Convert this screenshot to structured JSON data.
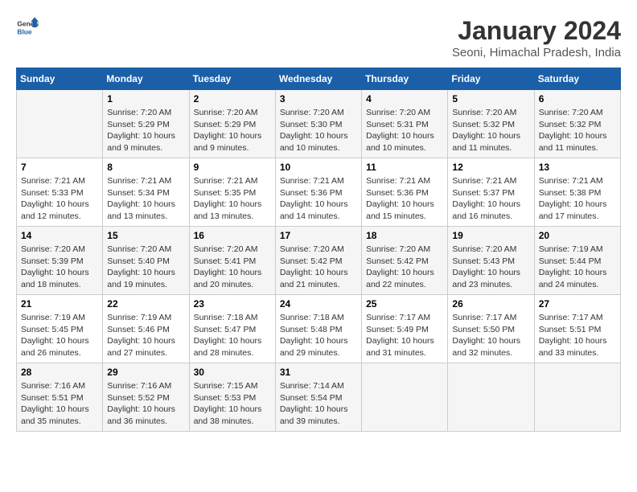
{
  "logo": {
    "text_general": "General",
    "text_blue": "Blue"
  },
  "header": {
    "month": "January 2024",
    "location": "Seoni, Himachal Pradesh, India"
  },
  "weekdays": [
    "Sunday",
    "Monday",
    "Tuesday",
    "Wednesday",
    "Thursday",
    "Friday",
    "Saturday"
  ],
  "weeks": [
    [
      {
        "day": "",
        "info": ""
      },
      {
        "day": "1",
        "info": "Sunrise: 7:20 AM\nSunset: 5:29 PM\nDaylight: 10 hours\nand 9 minutes."
      },
      {
        "day": "2",
        "info": "Sunrise: 7:20 AM\nSunset: 5:29 PM\nDaylight: 10 hours\nand 9 minutes."
      },
      {
        "day": "3",
        "info": "Sunrise: 7:20 AM\nSunset: 5:30 PM\nDaylight: 10 hours\nand 10 minutes."
      },
      {
        "day": "4",
        "info": "Sunrise: 7:20 AM\nSunset: 5:31 PM\nDaylight: 10 hours\nand 10 minutes."
      },
      {
        "day": "5",
        "info": "Sunrise: 7:20 AM\nSunset: 5:32 PM\nDaylight: 10 hours\nand 11 minutes."
      },
      {
        "day": "6",
        "info": "Sunrise: 7:20 AM\nSunset: 5:32 PM\nDaylight: 10 hours\nand 11 minutes."
      }
    ],
    [
      {
        "day": "7",
        "info": "Sunrise: 7:21 AM\nSunset: 5:33 PM\nDaylight: 10 hours\nand 12 minutes."
      },
      {
        "day": "8",
        "info": "Sunrise: 7:21 AM\nSunset: 5:34 PM\nDaylight: 10 hours\nand 13 minutes."
      },
      {
        "day": "9",
        "info": "Sunrise: 7:21 AM\nSunset: 5:35 PM\nDaylight: 10 hours\nand 13 minutes."
      },
      {
        "day": "10",
        "info": "Sunrise: 7:21 AM\nSunset: 5:36 PM\nDaylight: 10 hours\nand 14 minutes."
      },
      {
        "day": "11",
        "info": "Sunrise: 7:21 AM\nSunset: 5:36 PM\nDaylight: 10 hours\nand 15 minutes."
      },
      {
        "day": "12",
        "info": "Sunrise: 7:21 AM\nSunset: 5:37 PM\nDaylight: 10 hours\nand 16 minutes."
      },
      {
        "day": "13",
        "info": "Sunrise: 7:21 AM\nSunset: 5:38 PM\nDaylight: 10 hours\nand 17 minutes."
      }
    ],
    [
      {
        "day": "14",
        "info": "Sunrise: 7:20 AM\nSunset: 5:39 PM\nDaylight: 10 hours\nand 18 minutes."
      },
      {
        "day": "15",
        "info": "Sunrise: 7:20 AM\nSunset: 5:40 PM\nDaylight: 10 hours\nand 19 minutes."
      },
      {
        "day": "16",
        "info": "Sunrise: 7:20 AM\nSunset: 5:41 PM\nDaylight: 10 hours\nand 20 minutes."
      },
      {
        "day": "17",
        "info": "Sunrise: 7:20 AM\nSunset: 5:42 PM\nDaylight: 10 hours\nand 21 minutes."
      },
      {
        "day": "18",
        "info": "Sunrise: 7:20 AM\nSunset: 5:42 PM\nDaylight: 10 hours\nand 22 minutes."
      },
      {
        "day": "19",
        "info": "Sunrise: 7:20 AM\nSunset: 5:43 PM\nDaylight: 10 hours\nand 23 minutes."
      },
      {
        "day": "20",
        "info": "Sunrise: 7:19 AM\nSunset: 5:44 PM\nDaylight: 10 hours\nand 24 minutes."
      }
    ],
    [
      {
        "day": "21",
        "info": "Sunrise: 7:19 AM\nSunset: 5:45 PM\nDaylight: 10 hours\nand 26 minutes."
      },
      {
        "day": "22",
        "info": "Sunrise: 7:19 AM\nSunset: 5:46 PM\nDaylight: 10 hours\nand 27 minutes."
      },
      {
        "day": "23",
        "info": "Sunrise: 7:18 AM\nSunset: 5:47 PM\nDaylight: 10 hours\nand 28 minutes."
      },
      {
        "day": "24",
        "info": "Sunrise: 7:18 AM\nSunset: 5:48 PM\nDaylight: 10 hours\nand 29 minutes."
      },
      {
        "day": "25",
        "info": "Sunrise: 7:17 AM\nSunset: 5:49 PM\nDaylight: 10 hours\nand 31 minutes."
      },
      {
        "day": "26",
        "info": "Sunrise: 7:17 AM\nSunset: 5:50 PM\nDaylight: 10 hours\nand 32 minutes."
      },
      {
        "day": "27",
        "info": "Sunrise: 7:17 AM\nSunset: 5:51 PM\nDaylight: 10 hours\nand 33 minutes."
      }
    ],
    [
      {
        "day": "28",
        "info": "Sunrise: 7:16 AM\nSunset: 5:51 PM\nDaylight: 10 hours\nand 35 minutes."
      },
      {
        "day": "29",
        "info": "Sunrise: 7:16 AM\nSunset: 5:52 PM\nDaylight: 10 hours\nand 36 minutes."
      },
      {
        "day": "30",
        "info": "Sunrise: 7:15 AM\nSunset: 5:53 PM\nDaylight: 10 hours\nand 38 minutes."
      },
      {
        "day": "31",
        "info": "Sunrise: 7:14 AM\nSunset: 5:54 PM\nDaylight: 10 hours\nand 39 minutes."
      },
      {
        "day": "",
        "info": ""
      },
      {
        "day": "",
        "info": ""
      },
      {
        "day": "",
        "info": ""
      }
    ]
  ]
}
